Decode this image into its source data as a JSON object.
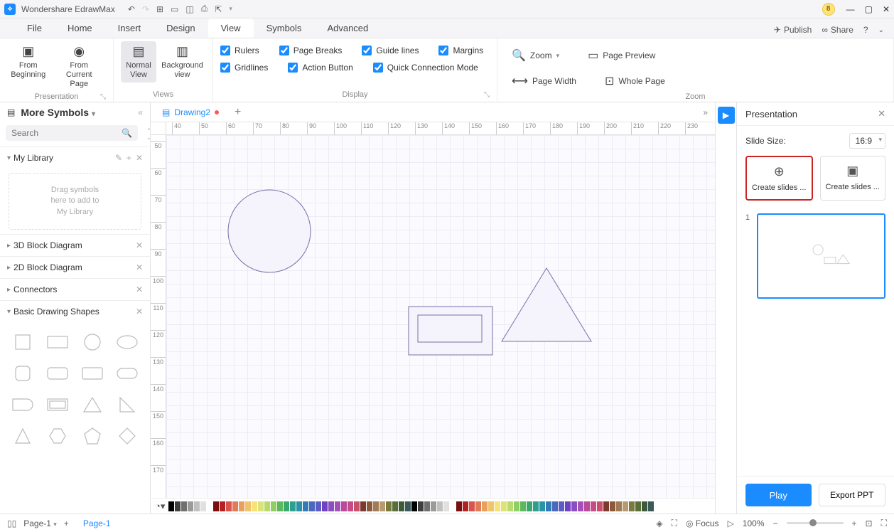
{
  "app": {
    "title": "Wondershare EdrawMax",
    "badge": "8"
  },
  "menu": {
    "tabs": [
      "File",
      "Home",
      "Insert",
      "Design",
      "View",
      "Symbols",
      "Advanced"
    ],
    "active": "View",
    "right": {
      "publish": "Publish",
      "share": "Share"
    }
  },
  "ribbon": {
    "presentation": {
      "label": "Presentation",
      "from_beginning": "From\nBeginning",
      "from_current": "From Current\nPage"
    },
    "views": {
      "label": "Views",
      "normal": "Normal\nView",
      "background": "Background\nview"
    },
    "display": {
      "label": "Display",
      "rulers": "Rulers",
      "gridlines": "Gridlines",
      "page_breaks": "Page Breaks",
      "action_button": "Action Button",
      "guide_lines": "Guide lines",
      "quick_connection": "Quick Connection Mode",
      "margins": "Margins"
    },
    "zoom": {
      "label": "Zoom",
      "zoom": "Zoom",
      "page_width": "Page Width",
      "page_preview": "Page Preview",
      "whole_page": "Whole Page"
    }
  },
  "left_panel": {
    "title": "More Symbols",
    "search_placeholder": "Search",
    "my_library": "My Library",
    "drop_hint": "Drag symbols\nhere to add to\nMy Library",
    "sections": [
      "3D Block Diagram",
      "2D Block Diagram",
      "Connectors",
      "Basic Drawing Shapes"
    ]
  },
  "doc": {
    "tab_name": "Drawing2"
  },
  "ruler_h": [
    "40",
    "50",
    "60",
    "70",
    "80",
    "90",
    "100",
    "110",
    "120",
    "130",
    "140",
    "150",
    "160",
    "170",
    "180",
    "190",
    "200",
    "210",
    "220",
    "230"
  ],
  "ruler_v": [
    "50",
    "60",
    "70",
    "80",
    "90",
    "100",
    "110",
    "120",
    "130",
    "140",
    "150",
    "160",
    "170"
  ],
  "right_panel": {
    "title": "Presentation",
    "slide_size_label": "Slide Size:",
    "slide_size_value": "16:9",
    "create_slides": "Create slides ...",
    "slide_num": "1",
    "play": "Play",
    "export": "Export PPT"
  },
  "status": {
    "page_select": "Page-1",
    "page_tab": "Page-1",
    "focus": "Focus",
    "zoom": "100%"
  },
  "colors": [
    "#000000",
    "#3f3f3f",
    "#707070",
    "#9a9a9a",
    "#c0c0c0",
    "#e0e0e0",
    "#ffffff",
    "#7a0f0f",
    "#b22222",
    "#d9534f",
    "#e07b5a",
    "#e8a05c",
    "#f0c36d",
    "#f7e27a",
    "#dce27a",
    "#b8d96e",
    "#8fce63",
    "#5cb85c",
    "#3aa76d",
    "#2e9e8f",
    "#2a93a8",
    "#337ab7",
    "#4a69bd",
    "#5c5cc4",
    "#6f42c1",
    "#8a4ec1",
    "#a350b8",
    "#b94a9c",
    "#c44d85",
    "#c94f6d",
    "#7a3b2e",
    "#8b5a3c",
    "#a17a56",
    "#b89a72",
    "#7a7a3e",
    "#5a6e3a",
    "#3e5a3a",
    "#3a5a5a"
  ]
}
